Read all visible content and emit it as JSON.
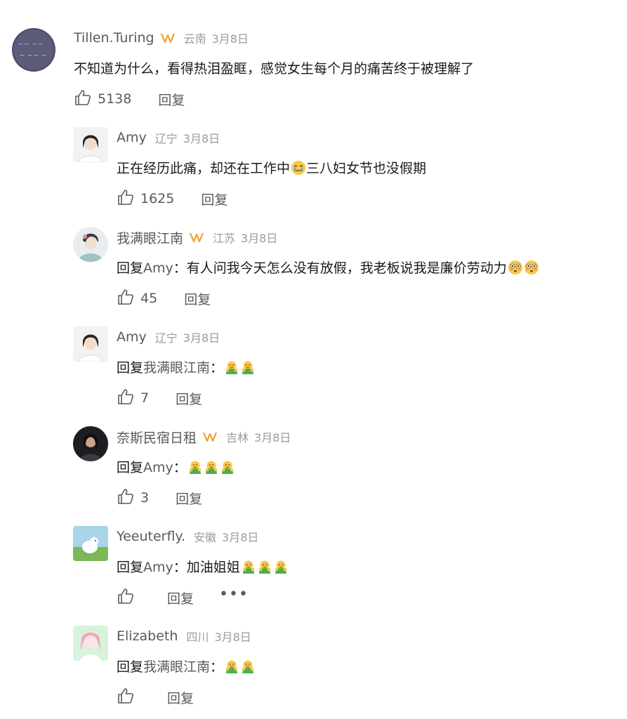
{
  "comments": [
    {
      "name": "Tillen.Turing",
      "badge": true,
      "location": "云南",
      "date": "3月8日",
      "prefix": "",
      "target": "",
      "body": "不知道为什么，看得热泪盈眶，感觉女生每个月的痛苦终于被理解了",
      "emoji_count": 0,
      "likes": "5138",
      "reply_label": "回复",
      "more": ""
    },
    {
      "name": "Amy",
      "badge": false,
      "location": "辽宁",
      "date": "3月8日",
      "prefix": "",
      "target": "",
      "body": "正在经历此痛，却还在工作中",
      "body2": "三八妇女节也没假期",
      "emoji_count": 0,
      "likes": "1625",
      "reply_label": "回复",
      "more": ""
    },
    {
      "name": "我满眼江南",
      "badge": true,
      "location": "江苏",
      "date": "3月8日",
      "prefix": "回复",
      "target": "Amy",
      "body": "：有人问我今天怎么没有放假，我老板说我是廉价劳动力",
      "emoji_count": 2,
      "likes": "45",
      "reply_label": "回复",
      "more": ""
    },
    {
      "name": "Amy",
      "badge": false,
      "location": "辽宁",
      "date": "3月8日",
      "prefix": "回复",
      "target": "我满眼江南",
      "body": "：",
      "emoji_count": 2,
      "likes": "7",
      "reply_label": "回复",
      "more": ""
    },
    {
      "name": "奈斯民宿日租",
      "badge": true,
      "location": "吉林",
      "date": "3月8日",
      "prefix": "回复",
      "target": "Amy",
      "body": "：",
      "emoji_count": 3,
      "likes": "3",
      "reply_label": "回复",
      "more": ""
    },
    {
      "name": "Yeeuterfly.",
      "badge": false,
      "location": "安徽",
      "date": "3月8日",
      "prefix": "回复",
      "target": "Amy",
      "body": "：加油姐姐",
      "emoji_count": 3,
      "likes": "",
      "reply_label": "回复",
      "more": "•••"
    },
    {
      "name": "Elizabeth",
      "badge": false,
      "location": "四川",
      "date": "3月8日",
      "prefix": "回复",
      "target": "我满眼江南",
      "body": "：",
      "emoji_count": 2,
      "likes": "",
      "reply_label": "回复",
      "more": ""
    }
  ],
  "colors": {
    "name": "#5a5a5a",
    "meta": "#9b9b9b",
    "text": "#1a1a1a",
    "badge": "#f0a030"
  },
  "icons": {
    "like": "thumbs-up-icon",
    "badge": "vip-badge-icon",
    "emoji_hug": "hug-emoji-icon",
    "emoji_flushed": "flushed-emoji-icon",
    "emoji_cry": "crying-emoji-icon",
    "more": "more-dots-icon"
  }
}
